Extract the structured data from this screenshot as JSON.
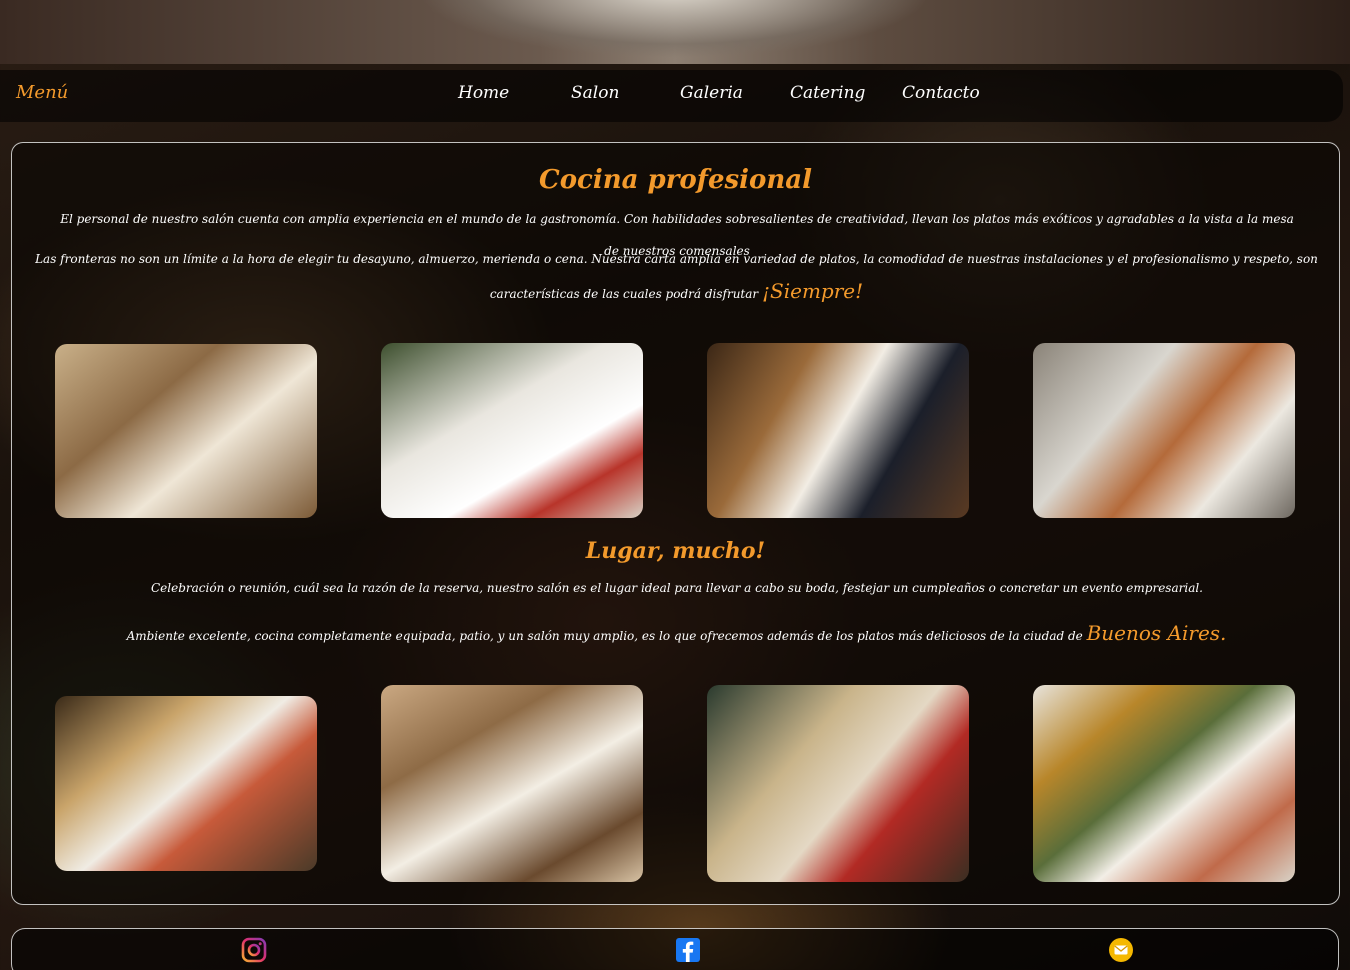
{
  "nav": {
    "brand": "Menú",
    "links": [
      "Home",
      "Salon",
      "Galeria",
      "Catering",
      "Contacto"
    ]
  },
  "section1": {
    "title": "Cocina profesional",
    "para1": "El personal de nuestro salón cuenta con amplia experiencia en el mundo de la gastronomía. Con habilidades sobresalientes de creatividad, llevan los platos más exóticos y agradables a la vista a la mesa de nuestros comensales",
    "para2": "Las fronteras no son un límite a la hora de elegir tu desayuno, almuerzo, merienda o cena. Nuestra carta amplia en variedad de platos, la comodidad de nuestras instalaciones y el profesionalismo y respeto, son características de las cuales podrá disfrutar",
    "para2_accent": "¡Siempre!"
  },
  "section2": {
    "title": "Lugar, mucho!",
    "para1": "Celebración o reunión, cuál sea la razón de la reserva, nuestro salón es el lugar ideal para llevar a cabo su boda, festejar un cumpleaños o concretar un evento empresarial.",
    "para2": "Ambiente excelente, cocina completamente equipada, patio, y un salón muy amplio, es lo que ofrecemos además de los platos más deliciosos de la ciudad de",
    "para2_accent": "Buenos Aires."
  },
  "colors": {
    "accent": "#f39a2c",
    "text": "#ffffff",
    "panel_border": "#ffffff"
  },
  "footer": {
    "icons": [
      "instagram-icon",
      "facebook-icon",
      "email-icon"
    ]
  }
}
